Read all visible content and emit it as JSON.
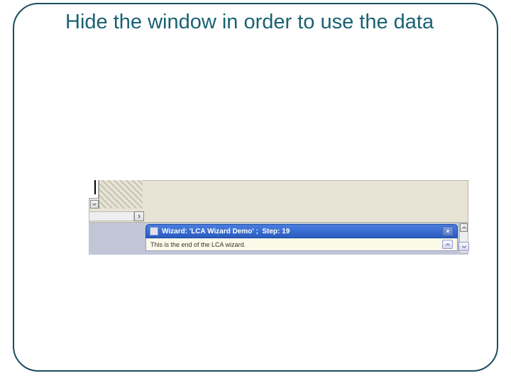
{
  "slide": {
    "title": "Hide the window in order to use the data"
  },
  "wizard_window": {
    "titlebar_prefix": "Wizard: ",
    "wizard_name": "'LCA Wizard Demo' ;",
    "step_label": "Step:",
    "step_number": "19",
    "body_text": "This is the end of the LCA wizard."
  },
  "icons": {
    "close": "×",
    "chevron_up": "chevron-up-icon",
    "chevron_down": "chevron-down-icon",
    "chevron_right": "chevron-right-icon"
  }
}
